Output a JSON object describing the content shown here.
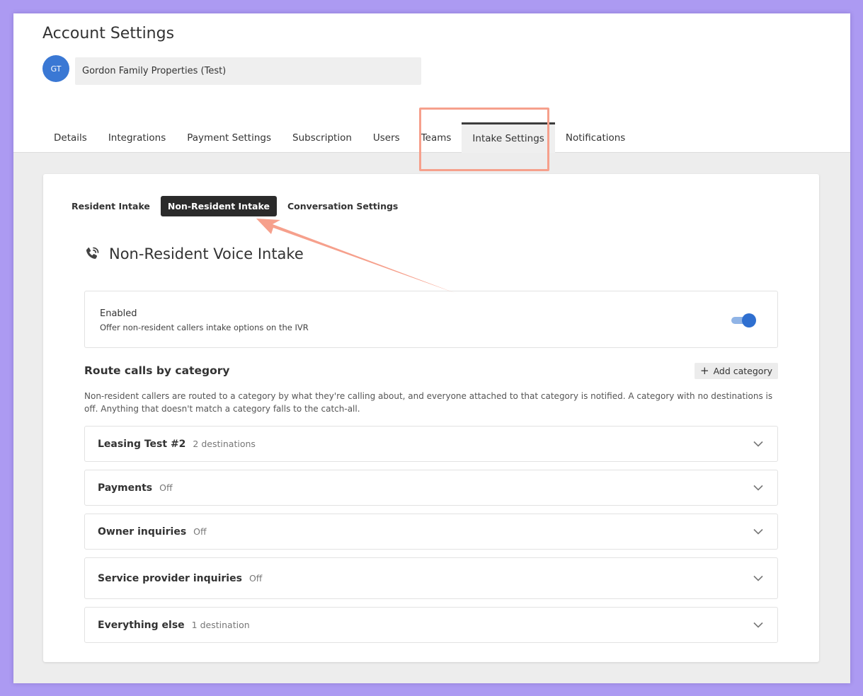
{
  "header": {
    "title": "Account Settings",
    "avatar_initials": "GT",
    "account_name": "Gordon Family Properties (Test)"
  },
  "tabs": [
    {
      "label": "Details"
    },
    {
      "label": "Integrations"
    },
    {
      "label": "Payment Settings"
    },
    {
      "label": "Subscription"
    },
    {
      "label": "Users"
    },
    {
      "label": "Teams"
    },
    {
      "label": "Intake Settings",
      "active": true
    },
    {
      "label": "Notifications"
    }
  ],
  "subtabs": [
    {
      "label": "Resident Intake"
    },
    {
      "label": "Non-Resident Intake",
      "active": true
    },
    {
      "label": "Conversation Settings"
    }
  ],
  "section": {
    "title": "Non-Resident Voice Intake",
    "icon": "phone-icon"
  },
  "enabled_panel": {
    "label": "Enabled",
    "description": "Offer non-resident callers intake options on the IVR",
    "toggle_on": true
  },
  "routing": {
    "title": "Route calls by category",
    "add_button": "Add category",
    "description": "Non-resident callers are routed to a category by what they're calling about, and everyone attached to that category is notified. A category with no destinations is off. Anything that doesn't match a category falls to the catch-all.",
    "categories": [
      {
        "name": "Leasing Test #2",
        "status": "2 destinations"
      },
      {
        "name": "Payments",
        "status": "Off"
      },
      {
        "name": "Owner inquiries",
        "status": "Off"
      },
      {
        "name": "Service provider inquiries",
        "status": "Off"
      },
      {
        "name": "Everything else",
        "status": "1 destination"
      }
    ]
  },
  "colors": {
    "background": "#ac9af2",
    "accent": "#2f6fd0",
    "annotation": "#f6a08c"
  }
}
